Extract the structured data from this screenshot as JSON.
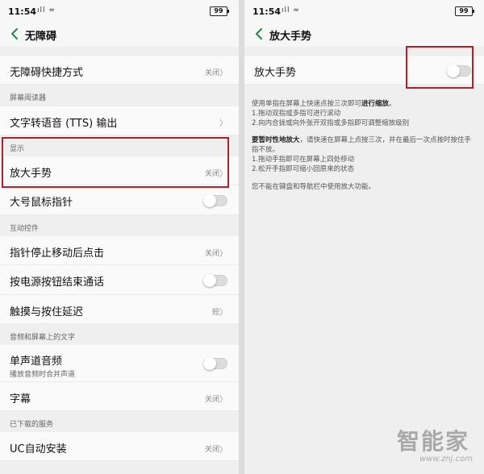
{
  "status_bar": {
    "time": "11:54",
    "signal": "ıll ≈",
    "battery": "99"
  },
  "left": {
    "title": "无障碍",
    "rows": {
      "shortcut": {
        "label": "无障碍快捷方式",
        "value": "关闭"
      },
      "section_reader": "屏幕阅读器",
      "tts": {
        "label": "文字转语音 (TTS) 输出"
      },
      "section_display": "显示",
      "magnify": {
        "label": "放大手势",
        "value": "关闭"
      },
      "large_pointer": {
        "label": "大号鼠标指针"
      },
      "section_interaction": "互动控件",
      "dwell_click": {
        "label": "指针停止移动后点击",
        "value": "关闭"
      },
      "power_ends_call": {
        "label": "按电源按钮结束通话"
      },
      "touch_delay": {
        "label": "触摸与按住延迟",
        "value": "短"
      },
      "section_audio": "音频和屏幕上的文字",
      "mono_audio": {
        "label": "单声道音频",
        "sub": "播放音频时合并声道"
      },
      "captions": {
        "label": "字幕",
        "value": "关闭"
      },
      "section_downloaded": "已下载的服务",
      "uc_install": {
        "label": "UC自动安装",
        "value": "关闭"
      }
    }
  },
  "right": {
    "title": "放大手势",
    "toggle_label": "放大手势",
    "desc1_intro": "使用单指在屏幕上快速点按三次即可",
    "desc1_bold": "进行缩放",
    "desc1_end": "。",
    "desc1_line2": "1.拖动双指或多指可进行滚动",
    "desc1_line3": "2.向内合拢或向外张开双指或多指即可调整缩放级别",
    "desc2_bold": "要暂时性地放大",
    "desc2_rest": "，请快速在屏幕上点按三次，并在最后一次点按时按住手指不放。",
    "desc2_line2": "1.拖动手指即可在屏幕上四处移动",
    "desc2_line3": "2.松开手指即可缩小回原来的状态",
    "desc3": "您不能在键盘和导航栏中使用放大功能。"
  },
  "watermark": {
    "text": "智能家",
    "url": "www.znj.com"
  },
  "colors": {
    "accent": "#2e8b57",
    "highlight": "#b2212b"
  }
}
